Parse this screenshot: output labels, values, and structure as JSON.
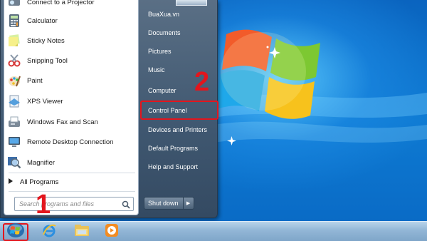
{
  "desktop": {
    "site": "BuaXua.vn"
  },
  "start_menu": {
    "programs": [
      {
        "label": "Connect to a Projector",
        "icon": "projector-icon"
      },
      {
        "label": "Calculator",
        "icon": "calculator-icon"
      },
      {
        "label": "Sticky Notes",
        "icon": "sticky-notes-icon"
      },
      {
        "label": "Snipping Tool",
        "icon": "snipping-tool-icon"
      },
      {
        "label": "Paint",
        "icon": "paint-icon"
      },
      {
        "label": "XPS Viewer",
        "icon": "xps-viewer-icon"
      },
      {
        "label": "Windows Fax and Scan",
        "icon": "fax-scan-icon"
      },
      {
        "label": "Remote Desktop Connection",
        "icon": "remote-desktop-icon"
      },
      {
        "label": "Magnifier",
        "icon": "magnifier-icon"
      }
    ],
    "all_programs_label": "All Programs",
    "search_placeholder": "Search programs and files",
    "right_items": [
      {
        "label": "BuaXua.vn"
      },
      {
        "label": "Documents"
      },
      {
        "label": "Pictures"
      },
      {
        "label": "Music"
      },
      {
        "label": "Computer"
      },
      {
        "label": "Control Panel"
      },
      {
        "label": "Devices and Printers"
      },
      {
        "label": "Default Programs"
      },
      {
        "label": "Help and Support"
      }
    ],
    "shutdown_label": "Shut down"
  },
  "annotations": {
    "step_1": "1",
    "step_2": "2"
  },
  "colors": {
    "annotation_red": "#e3151d",
    "menu_right_pane": "#4a6179",
    "desktop_blue": "#0b6cc4"
  },
  "taskbar": {
    "start_button": "windows-start-orb-icon",
    "pinned": [
      "internet-explorer-icon",
      "windows-explorer-icon",
      "media-player-icon"
    ]
  }
}
